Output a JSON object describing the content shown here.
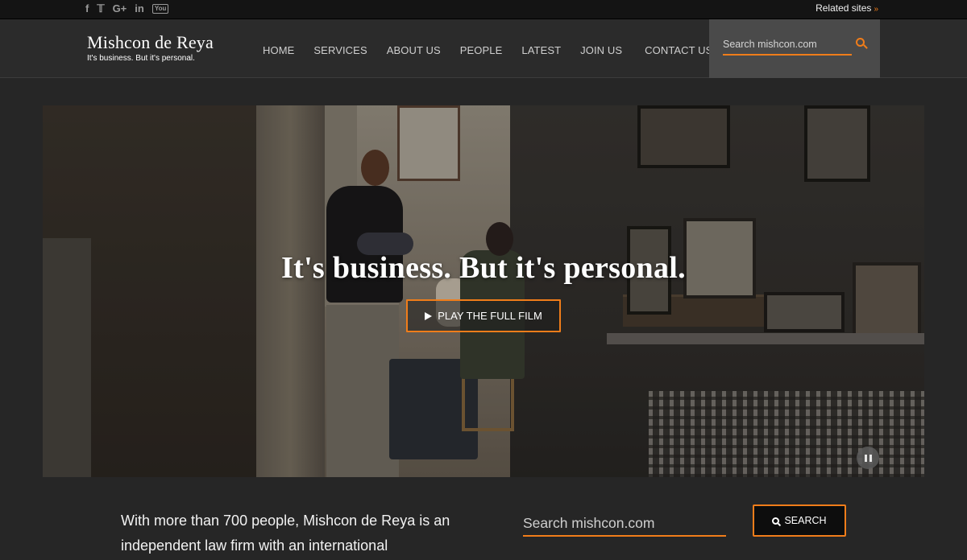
{
  "topbar": {
    "social": [
      {
        "name": "facebook-icon",
        "glyph": "f"
      },
      {
        "name": "twitter-icon",
        "glyph": "𝕋"
      },
      {
        "name": "google-plus-icon",
        "glyph": "G+"
      },
      {
        "name": "linkedin-icon",
        "glyph": "in"
      },
      {
        "name": "youtube-icon",
        "glyph": "You"
      }
    ],
    "related_label": "Related sites",
    "related_chevron": "»"
  },
  "header": {
    "logo_name": "Mishcon de Reya",
    "logo_tagline": "It's business. But it's personal.",
    "nav": [
      "HOME",
      "SERVICES",
      "ABOUT US",
      "PEOPLE",
      "LATEST",
      "JOIN US",
      "CONTACT US"
    ],
    "search_placeholder": "Search mishcon.com"
  },
  "hero": {
    "headline": "It's business. But it's personal.",
    "play_label": "PLAY THE FULL FILM"
  },
  "intro": {
    "text": "With more than 700 people, Mishcon de Reya is an independent law firm with an international",
    "search_placeholder": "Search mishcon.com",
    "search_button": "SEARCH"
  },
  "colors": {
    "accent": "#f07d1a",
    "background": "#262626",
    "header": "#2b2b2b",
    "topbar": "#141414"
  }
}
